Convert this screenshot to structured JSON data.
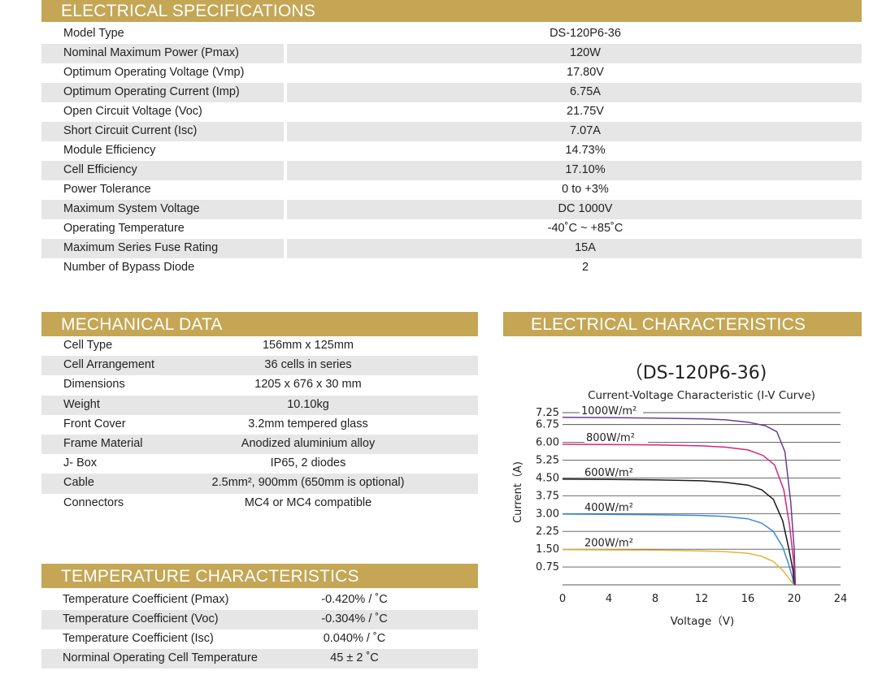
{
  "electrical": {
    "title": "ELECTRICAL SPECIFICATIONS",
    "rows": [
      {
        "label": "Model Type",
        "value": "DS-120P6-36"
      },
      {
        "label": "Nominal Maximum Power (Pmax)",
        "value": "120W"
      },
      {
        "label": "Optimum Operating Voltage (Vmp)",
        "value": "17.80V"
      },
      {
        "label": "Optimum Operating Current (Imp)",
        "value": "6.75A"
      },
      {
        "label": "Open Circuit Voltage (Voc)",
        "value": "21.75V"
      },
      {
        "label": "Short Circuit Current (Isc)",
        "value": "7.07A"
      },
      {
        "label": "Module Efficiency",
        "value": "14.73%"
      },
      {
        "label": "Cell Efficiency",
        "value": "17.10%"
      },
      {
        "label": "Power Tolerance",
        "value": "0 to +3%"
      },
      {
        "label": "Maximum System Voltage",
        "value": "DC 1000V"
      },
      {
        "label": "Operating  Temperature",
        "value": "-40˚C ~ +85˚C"
      },
      {
        "label": "Maximum Series Fuse Rating",
        "value": "15A"
      },
      {
        "label": "Number of Bypass Diode",
        "value": "2"
      }
    ]
  },
  "mechanical": {
    "title": "MECHANICAL DATA",
    "rows": [
      {
        "label": "Cell Type",
        "value": "156mm x 125mm"
      },
      {
        "label": "Cell Arrangement",
        "value": "36 cells in series"
      },
      {
        "label": "Dimensions",
        "value": "1205 x 676 x 30 mm"
      },
      {
        "label": "Weight",
        "value": "10.10kg"
      },
      {
        "label": "Front Cover",
        "value": "3.2mm tempered glass"
      },
      {
        "label": "Frame Material",
        "value": "Anodized aluminium alloy"
      },
      {
        "label": "J- Box",
        "value": "IP65, 2 diodes"
      },
      {
        "label": "Cable",
        "value": "2.5mm², 900mm (650mm is optional)"
      },
      {
        "label": "Connectors",
        "value": "MC4 or MC4 compatible"
      }
    ]
  },
  "temperature": {
    "title": "TEMPERATURE CHARACTERISTICS",
    "rows": [
      {
        "label": "Temperature Coefficient (Pmax)",
        "value": "-0.420% / ˚C"
      },
      {
        "label": "Temperature Coefficient (Voc)",
        "value": "-0.304% / ˚C"
      },
      {
        "label": "Temperature Coefficient (Isc)",
        "value": "0.040% / ˚C"
      },
      {
        "label": "Norminal Operating Cell Temperature",
        "value": "45 ± 2 ˚C"
      }
    ]
  },
  "characteristics": {
    "title": "ELECTRICAL CHARACTERISTICS"
  },
  "chart_data": {
    "type": "line",
    "title": "（DS-120P6-36)",
    "subtitle": "Current-Voltage Characteristic (I-V Curve)",
    "xlabel": "Voltage（V)",
    "ylabel": "Current（A)",
    "xlim": [
      0,
      24
    ],
    "ylim": [
      0,
      7.25
    ],
    "xticks": [
      "0",
      "4",
      "8",
      "12",
      "16",
      "20",
      "24"
    ],
    "yticks": [
      "0.75",
      "1.50",
      "2.25",
      "3.00",
      "3.75",
      "4.50",
      "5.25",
      "6.00",
      "6.75",
      "7.25"
    ],
    "grid": true,
    "series": [
      {
        "name": "1000W/m²",
        "color": "#6a3d8f",
        "points": [
          [
            0,
            7.05
          ],
          [
            4,
            7.04
          ],
          [
            8,
            7.02
          ],
          [
            12,
            6.99
          ],
          [
            14,
            6.95
          ],
          [
            16,
            6.85
          ],
          [
            17.5,
            6.7
          ],
          [
            18.5,
            6.45
          ],
          [
            19.2,
            5.6
          ],
          [
            19.7,
            3.5
          ],
          [
            20.0,
            1.5
          ],
          [
            20.1,
            0
          ]
        ]
      },
      {
        "name": "800W/m²",
        "color": "#d6247d",
        "points": [
          [
            0,
            5.92
          ],
          [
            4,
            5.91
          ],
          [
            8,
            5.89
          ],
          [
            12,
            5.85
          ],
          [
            14,
            5.8
          ],
          [
            16,
            5.68
          ],
          [
            17.3,
            5.45
          ],
          [
            18.3,
            5.05
          ],
          [
            19.1,
            4.0
          ],
          [
            19.6,
            2.5
          ],
          [
            19.95,
            1.0
          ],
          [
            20.05,
            0
          ]
        ]
      },
      {
        "name": "600W/m²",
        "color": "#1a1a1a",
        "points": [
          [
            0,
            4.45
          ],
          [
            4,
            4.44
          ],
          [
            8,
            4.42
          ],
          [
            12,
            4.38
          ],
          [
            14,
            4.32
          ],
          [
            16,
            4.2
          ],
          [
            17.2,
            4.0
          ],
          [
            18.2,
            3.6
          ],
          [
            19.0,
            2.7
          ],
          [
            19.5,
            1.6
          ],
          [
            19.9,
            0.6
          ],
          [
            20.0,
            0
          ]
        ]
      },
      {
        "name": "400W/m²",
        "color": "#3a8ad6",
        "points": [
          [
            0,
            2.98
          ],
          [
            4,
            2.97
          ],
          [
            8,
            2.95
          ],
          [
            12,
            2.92
          ],
          [
            14,
            2.88
          ],
          [
            16,
            2.78
          ],
          [
            17.2,
            2.6
          ],
          [
            18.2,
            2.25
          ],
          [
            19.0,
            1.6
          ],
          [
            19.5,
            0.9
          ],
          [
            19.85,
            0.3
          ],
          [
            19.95,
            0
          ]
        ]
      },
      {
        "name": "200W/m²",
        "color": "#e8b43a",
        "points": [
          [
            0,
            1.48
          ],
          [
            4,
            1.47
          ],
          [
            8,
            1.46
          ],
          [
            12,
            1.43
          ],
          [
            14,
            1.4
          ],
          [
            16,
            1.33
          ],
          [
            17.2,
            1.2
          ],
          [
            18.2,
            0.98
          ],
          [
            19.0,
            0.62
          ],
          [
            19.5,
            0.3
          ],
          [
            19.85,
            0.08
          ],
          [
            19.9,
            0
          ]
        ]
      }
    ]
  }
}
